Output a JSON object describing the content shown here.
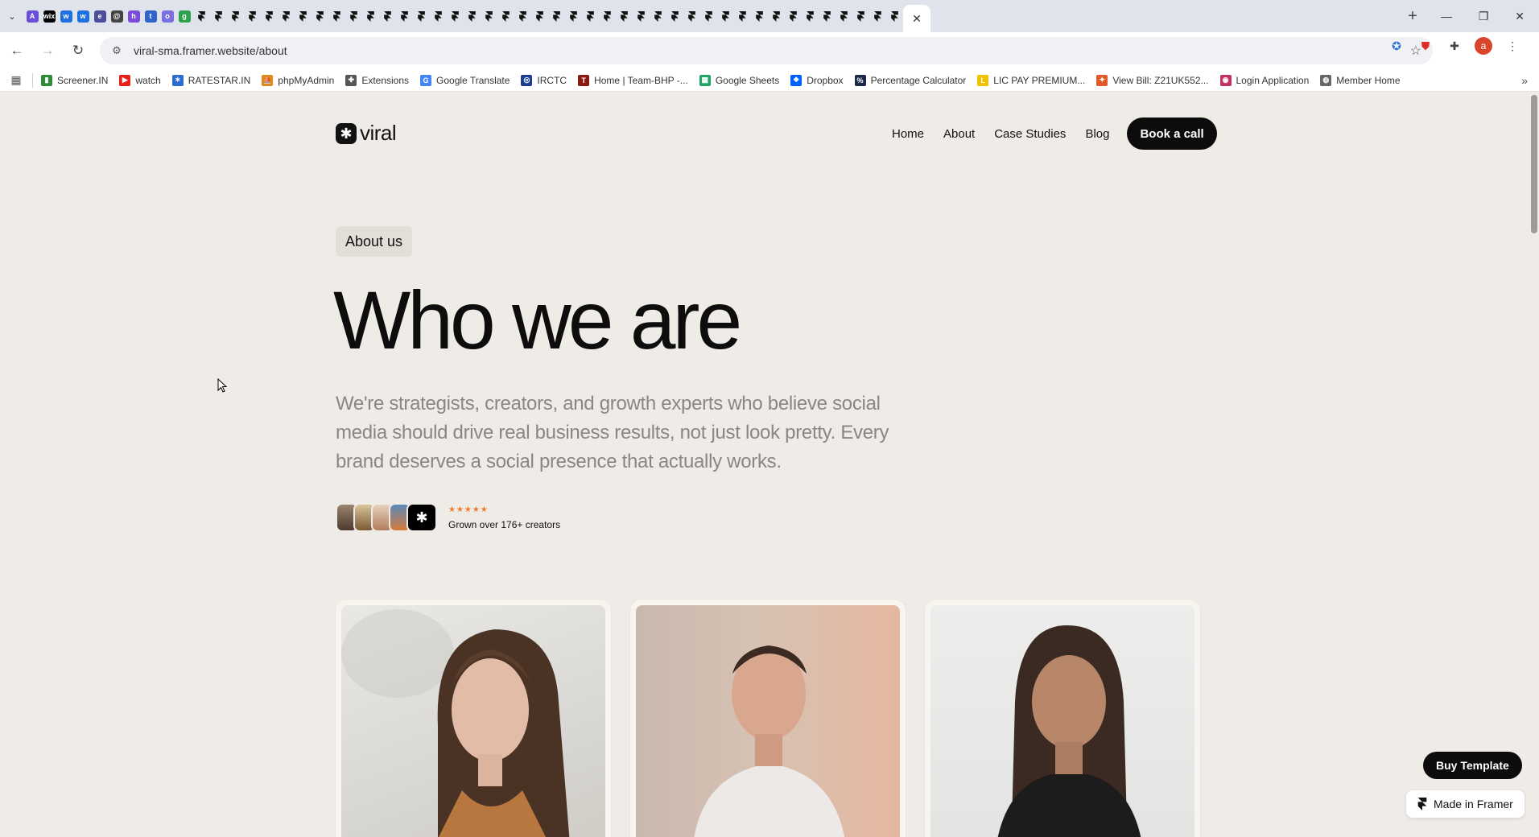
{
  "browser": {
    "tabs": [
      {
        "icon": "A",
        "color": "#6b4fd8"
      },
      {
        "icon": "wix",
        "color": "#000000"
      },
      {
        "icon": "w",
        "color": "#1e6fe0"
      },
      {
        "icon": "w",
        "color": "#1e6fe0"
      },
      {
        "icon": "e",
        "color": "#4a4d9a"
      },
      {
        "icon": "@",
        "color": "#444444"
      },
      {
        "icon": "h",
        "color": "#7c4ad8"
      },
      {
        "icon": "t",
        "color": "#2f64c8"
      },
      {
        "icon": "o",
        "color": "#7a6fe0"
      },
      {
        "icon": "g",
        "color": "#2ba24c"
      }
    ],
    "framer_tab_count": 42,
    "active_tab_close": "✕",
    "new_tab": "+",
    "window_controls": {
      "minimize": "—",
      "restore": "❐",
      "close": "✕"
    },
    "url": "viral-sma.framer.website/about",
    "bookmarks": [
      {
        "label": "Screener.IN",
        "icon": "bar-chart-icon",
        "color": "#2e8b3a",
        "glyph": "▮"
      },
      {
        "label": "watch",
        "icon": "youtube-icon",
        "color": "#e62117",
        "glyph": "▶"
      },
      {
        "label": "RATESTAR.IN",
        "icon": "ratestar-icon",
        "color": "#2d6ccf",
        "glyph": "✶"
      },
      {
        "label": "phpMyAdmin",
        "icon": "phpmyadmin-icon",
        "color": "#e2891b",
        "glyph": "⛵"
      },
      {
        "label": "Extensions",
        "icon": "puzzle-icon",
        "color": "#555555",
        "glyph": "✚"
      },
      {
        "label": "Google Translate",
        "icon": "translate-icon",
        "color": "#4285f4",
        "glyph": "G"
      },
      {
        "label": "IRCTC",
        "icon": "irctc-icon",
        "color": "#1c3f94",
        "glyph": "◎"
      },
      {
        "label": "Home | Team-BHP -...",
        "icon": "teambhp-icon",
        "color": "#8a1a10",
        "glyph": "T"
      },
      {
        "label": "Google Sheets",
        "icon": "sheets-icon",
        "color": "#1fa463",
        "glyph": "▦"
      },
      {
        "label": "Dropbox",
        "icon": "dropbox-icon",
        "color": "#0061fe",
        "glyph": "❖"
      },
      {
        "label": "Percentage Calculator",
        "icon": "percent-icon",
        "color": "#1b2a4a",
        "glyph": "%"
      },
      {
        "label": "LIC PAY PREMIUM...",
        "icon": "lic-icon",
        "color": "#f2c200",
        "glyph": "L"
      },
      {
        "label": "View Bill: Z21UK552...",
        "icon": "bill-icon",
        "color": "#e05a2a",
        "glyph": "✦"
      },
      {
        "label": "Login Application",
        "icon": "login-icon",
        "color": "#c0335e",
        "glyph": "◉"
      },
      {
        "label": "Member Home",
        "icon": "globe-icon",
        "color": "#666666",
        "glyph": "◍"
      }
    ],
    "profile_initial": "a"
  },
  "site": {
    "logo_text": "viral",
    "logo_glyph": "✱",
    "nav": {
      "home": "Home",
      "about": "About",
      "case_studies": "Case Studies",
      "blog": "Blog",
      "cta": "Book a call"
    }
  },
  "hero": {
    "badge": "About us",
    "title": "Who we are",
    "description": "We're strategists, creators, and growth experts who believe social media should drive real business results, not just look pretty. Every brand deserves a social presence that actually works.",
    "stars": "★★★★★",
    "rating_text": "Grown over 176+ creators"
  },
  "team": {
    "cards": [
      {
        "alt": "team-member-1"
      },
      {
        "alt": "team-member-2"
      },
      {
        "alt": "team-member-3"
      }
    ]
  },
  "floating": {
    "buy_template": "Buy Template",
    "made_in_framer": "Made in Framer"
  }
}
